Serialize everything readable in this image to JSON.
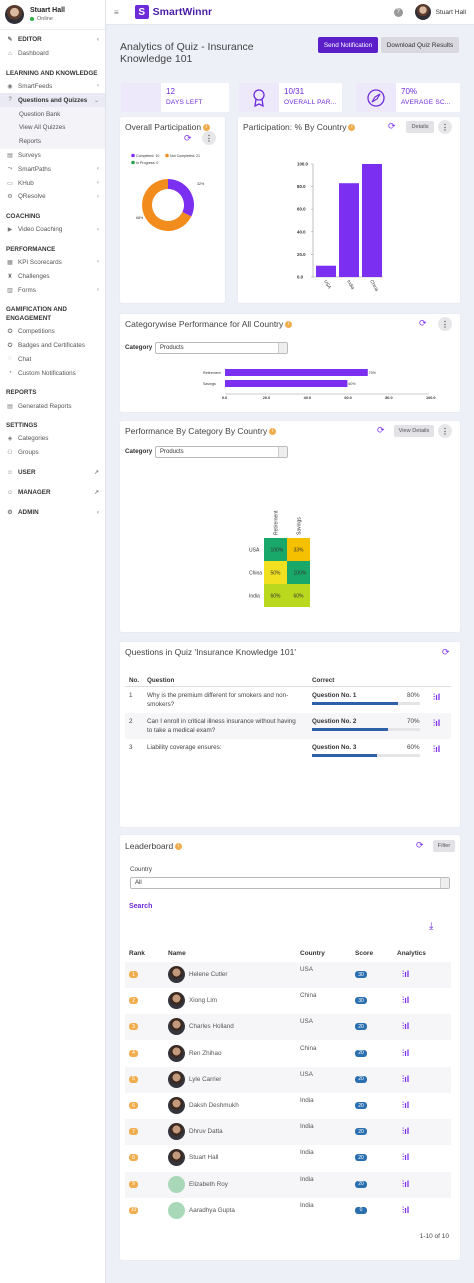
{
  "sidebar": {
    "user_name": "Stuart Hall",
    "user_status": "Online",
    "groups": {
      "editor": "EDITOR",
      "learning": "LEARNING AND KNOWLEDGE",
      "coaching": "COACHING",
      "performance": "PERFORMANCE",
      "gamification": "GAMIFICATION AND ENGAGEMENT",
      "reports": "REPORTS",
      "settings": "SETTINGS",
      "user": "USER",
      "manager": "MANAGER",
      "admin": "ADMIN"
    },
    "items": {
      "dashboard": "Dashboard",
      "smartfeeds": "SmartFeeds",
      "questions_quizzes": "Questions and Quizzes",
      "question_bank": "Question Bank",
      "view_all_quizzes": "View All Quizzes",
      "reports": "Reports",
      "surveys": "Surveys",
      "smartpaths": "SmartPaths",
      "khub": "KHub",
      "qresolve": "QResolve",
      "video_coaching": "Video Coaching",
      "kpi_scorecards": "KPI Scorecards",
      "challenges": "Challenges",
      "forms": "Forms",
      "competitions": "Competitions",
      "badges": "Badges and Certificates",
      "chat": "Chat",
      "custom_notifications": "Custom Notifications",
      "generated_reports": "Generated Reports",
      "categories": "Categories",
      "groups": "Groups"
    }
  },
  "topbar": {
    "brand": "SmartWinnr",
    "help": "?",
    "user_name": "Stuart Hall"
  },
  "page": {
    "title_line1": "Analytics of Quiz - Insurance",
    "title_line2": "Knowledge 101",
    "send_notification": "Send Notification",
    "download_results": "Download Quiz Results"
  },
  "stats": [
    {
      "value": "12",
      "label": "DAYS LEFT"
    },
    {
      "value": "10/31",
      "label": "OVERALL PAR..."
    },
    {
      "value": "70%",
      "label": "AVERAGE SC..."
    }
  ],
  "participation": {
    "title": "Overall Participation",
    "legend": [
      "Completed: 10",
      "Not Completed: 21",
      "In Progress: 0"
    ],
    "label_completed": "32%",
    "label_not_completed": "68%"
  },
  "country_participation": {
    "title": "Participation: % By Country",
    "details": "Details"
  },
  "category_perf": {
    "title": "Categorywise Performance for All Country",
    "category_label": "Category",
    "category_value": "Products"
  },
  "perf_by_cat": {
    "title": "Performance By Category By Country",
    "view_details": "View Details",
    "category_label": "Category",
    "category_value": "Products"
  },
  "questions": {
    "title": "Questions in Quiz 'Insurance Knowledge 101'",
    "col_no": "No.",
    "col_question": "Question",
    "col_correct": "Correct",
    "rows": [
      {
        "no": "1",
        "text": "Why is the premium different for smokers and non-smokers?",
        "label": "Question No. 1",
        "pct": "80%",
        "value": 80
      },
      {
        "no": "2",
        "text": "Can I enroll in critical illness insurance without having to take a medical exam?",
        "label": "Question No. 2",
        "pct": "70%",
        "value": 70
      },
      {
        "no": "3",
        "text": "Liability coverage ensures:",
        "label": "Question No. 3",
        "pct": "60%",
        "value": 60
      }
    ]
  },
  "leaderboard": {
    "title": "Leaderboard",
    "filter": "Filter",
    "country_label": "Country",
    "country_value": "All",
    "search": "Search",
    "col_rank": "Rank",
    "col_name": "Name",
    "col_country": "Country",
    "col_score": "Score",
    "col_analytics": "Analytics",
    "pagination": "1-10 of 10",
    "rows": [
      {
        "rank": "1",
        "name": "Helene Cutler",
        "country": "USA",
        "score": "30"
      },
      {
        "rank": "2",
        "name": "Xiong Lim",
        "country": "China",
        "score": "30"
      },
      {
        "rank": "3",
        "name": "Charles Holland",
        "country": "USA",
        "score": "20"
      },
      {
        "rank": "4",
        "name": "Ren Zhihao",
        "country": "China",
        "score": "20"
      },
      {
        "rank": "5",
        "name": "Lyle Carrier",
        "country": "USA",
        "score": "20"
      },
      {
        "rank": "6",
        "name": "Daksh Deshmukh",
        "country": "India",
        "score": "20"
      },
      {
        "rank": "7",
        "name": "Dhruv Datta",
        "country": "India",
        "score": "20"
      },
      {
        "rank": "8",
        "name": "Stuart Hall",
        "country": "India",
        "score": "20"
      },
      {
        "rank": "9",
        "name": "Elizabeth Roy",
        "country": "India",
        "score": "20"
      },
      {
        "rank": "10",
        "name": "Aaradhya Gupta",
        "country": "India",
        "score": "0"
      }
    ]
  },
  "chart_data": [
    {
      "type": "pie",
      "title": "Overall Participation",
      "categories": [
        "Completed",
        "Not Completed",
        "In Progress"
      ],
      "values": [
        10,
        21,
        0
      ],
      "colors": [
        "#7b2ff0",
        "#f28c1c",
        "#2aa34a"
      ]
    },
    {
      "type": "bar",
      "title": "Participation: % By Country",
      "categories": [
        "USA",
        "India",
        "China"
      ],
      "values": [
        10,
        83,
        100
      ],
      "ylim": [
        0,
        100
      ],
      "ticks": [
        "100.0",
        "80.0",
        "60.0",
        "40.0",
        "20.0",
        "0.0"
      ],
      "color": "#7b2ff0"
    },
    {
      "type": "bar",
      "orientation": "horizontal",
      "title": "Categorywise Performance for All Country",
      "categories": [
        "Retirement",
        "Savings"
      ],
      "values": [
        70,
        60
      ],
      "value_labels": [
        "70%",
        "60%"
      ],
      "xlim": [
        0,
        100
      ],
      "ticks": [
        "0.0",
        "20.0",
        "40.0",
        "60.0",
        "80.0",
        "100.0"
      ],
      "color": "#7b2ff0"
    },
    {
      "type": "heatmap",
      "title": "Performance By Category By Country",
      "columns": [
        "Retirement",
        "Savings"
      ],
      "rows": [
        "USA",
        "China",
        "India"
      ],
      "cells": [
        [
          "100%",
          "33%"
        ],
        [
          "50%",
          "100%"
        ],
        [
          "60%",
          "60%"
        ]
      ],
      "colors": [
        [
          "#1aa86a",
          "#f5c000"
        ],
        [
          "#f0e020",
          "#1aa86a"
        ],
        [
          "#b9d81e",
          "#b9d81e"
        ]
      ]
    }
  ]
}
